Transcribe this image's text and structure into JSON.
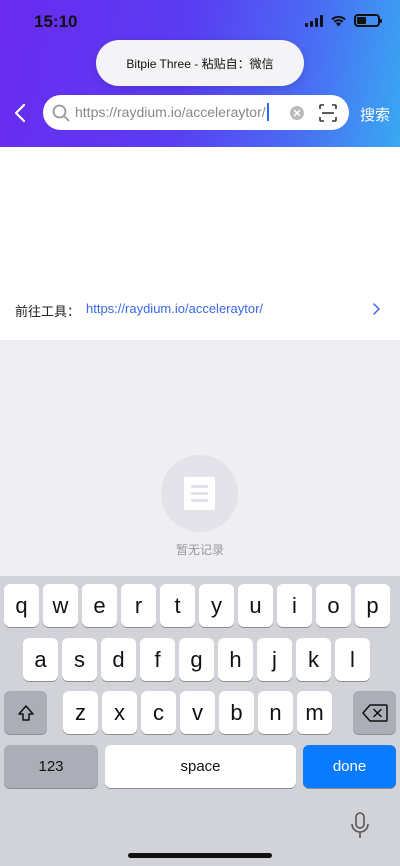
{
  "status": {
    "time": "15:10"
  },
  "paste_banner": {
    "text": "Bitpie Three - 粘贴自：微信"
  },
  "search": {
    "value": "https://raydium.io/acceleraytor/",
    "button_label": "搜索"
  },
  "goto": {
    "label": "前往工具：",
    "link": "https://raydium.io/acceleraytor/"
  },
  "empty": {
    "text": "暂无记录"
  },
  "keyboard": {
    "row1": [
      "q",
      "w",
      "e",
      "r",
      "t",
      "y",
      "u",
      "i",
      "o",
      "p"
    ],
    "row2": [
      "a",
      "s",
      "d",
      "f",
      "g",
      "h",
      "j",
      "k",
      "l"
    ],
    "row3": [
      "z",
      "x",
      "c",
      "v",
      "b",
      "n",
      "m"
    ],
    "numbers_label": "123",
    "space_label": "space",
    "done_label": "done"
  },
  "colors": {
    "accent": "#0a7aff",
    "link": "#3b68e8",
    "gradient_start": "#6a2bf0",
    "gradient_end": "#39a9f2"
  }
}
